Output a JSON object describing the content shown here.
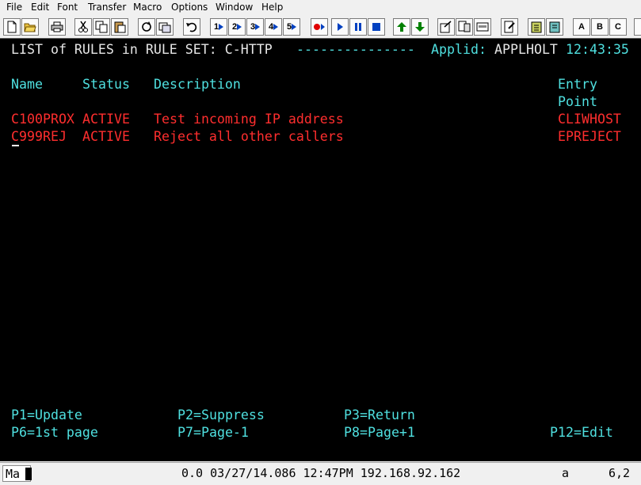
{
  "menu": [
    "File",
    "Edit",
    "Font",
    "Transfer",
    "Macro",
    "Options",
    "Window",
    "Help"
  ],
  "toolbar": {
    "session_labels": [
      "1",
      "2",
      "3",
      "4",
      "5"
    ],
    "letter_labels": [
      "A",
      "B",
      "C"
    ]
  },
  "screen": {
    "title": "LIST of RULES in RULE SET: C-HTTP",
    "dashes": "---------------",
    "applid_label": "Applid:",
    "applid": "APPLHOLT",
    "time": "12:43:35",
    "headers": {
      "name": "Name",
      "status": "Status",
      "description": "Description",
      "entry1": "Entry",
      "entry2": "Point"
    },
    "rows": [
      {
        "name": "C100PROX",
        "status": "ACTIVE",
        "description": "Test incoming IP address",
        "entry": "CLIWHOST"
      },
      {
        "name": "C999REJ",
        "status": "ACTIVE",
        "description": "Reject all other callers",
        "entry": "EPREJECT"
      }
    ],
    "pfkeys": {
      "p1": "P1=Update",
      "p2": "P2=Suppress",
      "p3": "P3=Return",
      "p6": "P6=1st page",
      "p7": "P7=Page-1",
      "p8": "P8=Page+1",
      "p12": "P12=Edit"
    }
  },
  "status_bar": {
    "mode": "Ma",
    "info": "0.0 03/27/14.086 12:47PM 192.168.92.162",
    "indicator": "a",
    "cursor_pos": "6,2"
  },
  "colors": {
    "background": "#000000",
    "white": "#e6e6e6",
    "cyan": "#4fe0e0",
    "red": "#ff2e2e"
  }
}
